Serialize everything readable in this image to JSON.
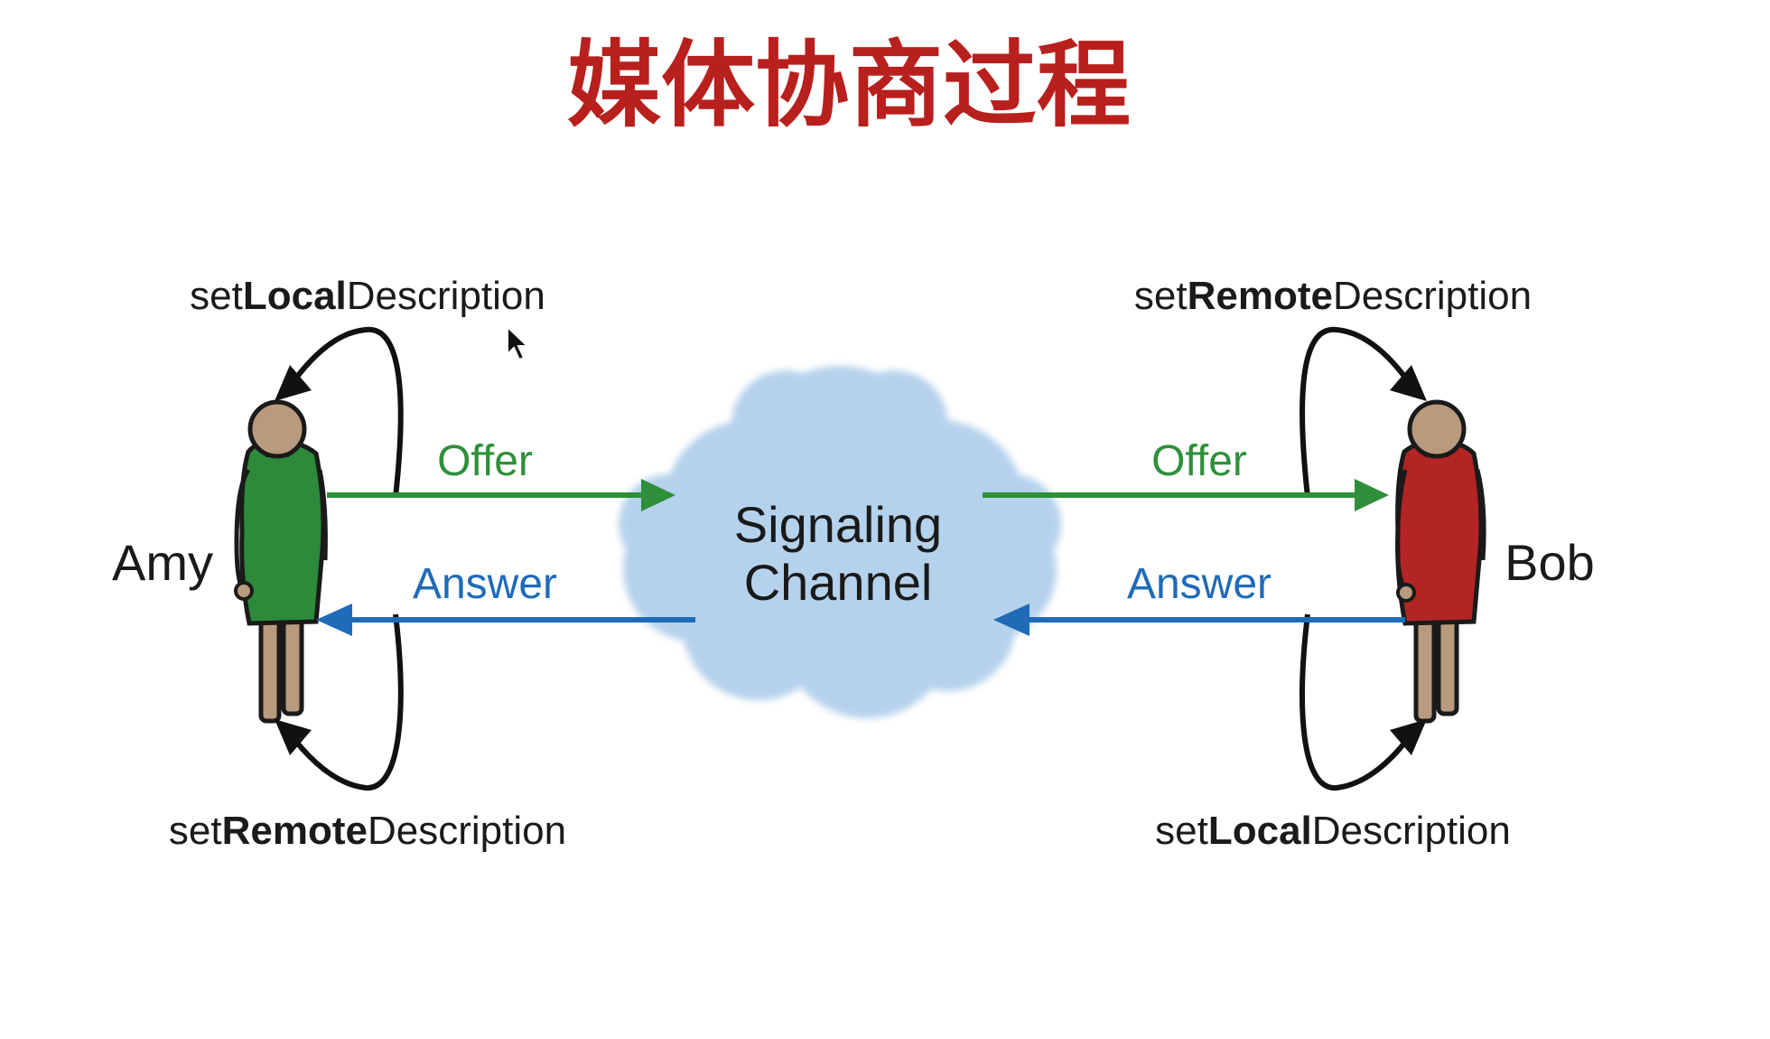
{
  "title": "媒体协商过程",
  "colors": {
    "title": "#b8201d",
    "offer": "#2f8f3a",
    "answer": "#1f6bb8",
    "cloud": "#b5d2ec",
    "amy_body": "#2c8a3a",
    "bob_body": "#b32424",
    "skin": "#b89a7e"
  },
  "amy": {
    "name": "Amy",
    "top_label": {
      "prefix": "set",
      "bold": "Local",
      "suffix": "Description"
    },
    "bottom_label": {
      "prefix": "set",
      "bold": "Remote",
      "suffix": "Description"
    }
  },
  "bob": {
    "name": "Bob",
    "top_label": {
      "prefix": "set",
      "bold": "Remote",
      "suffix": "Description"
    },
    "bottom_label": {
      "prefix": "set",
      "bold": "Local",
      "suffix": "Description"
    }
  },
  "signaling": {
    "line1": "Signaling",
    "line2": "Channel"
  },
  "messages": {
    "left_offer": "Offer",
    "left_answer": "Answer",
    "right_offer": "Offer",
    "right_answer": "Answer"
  }
}
